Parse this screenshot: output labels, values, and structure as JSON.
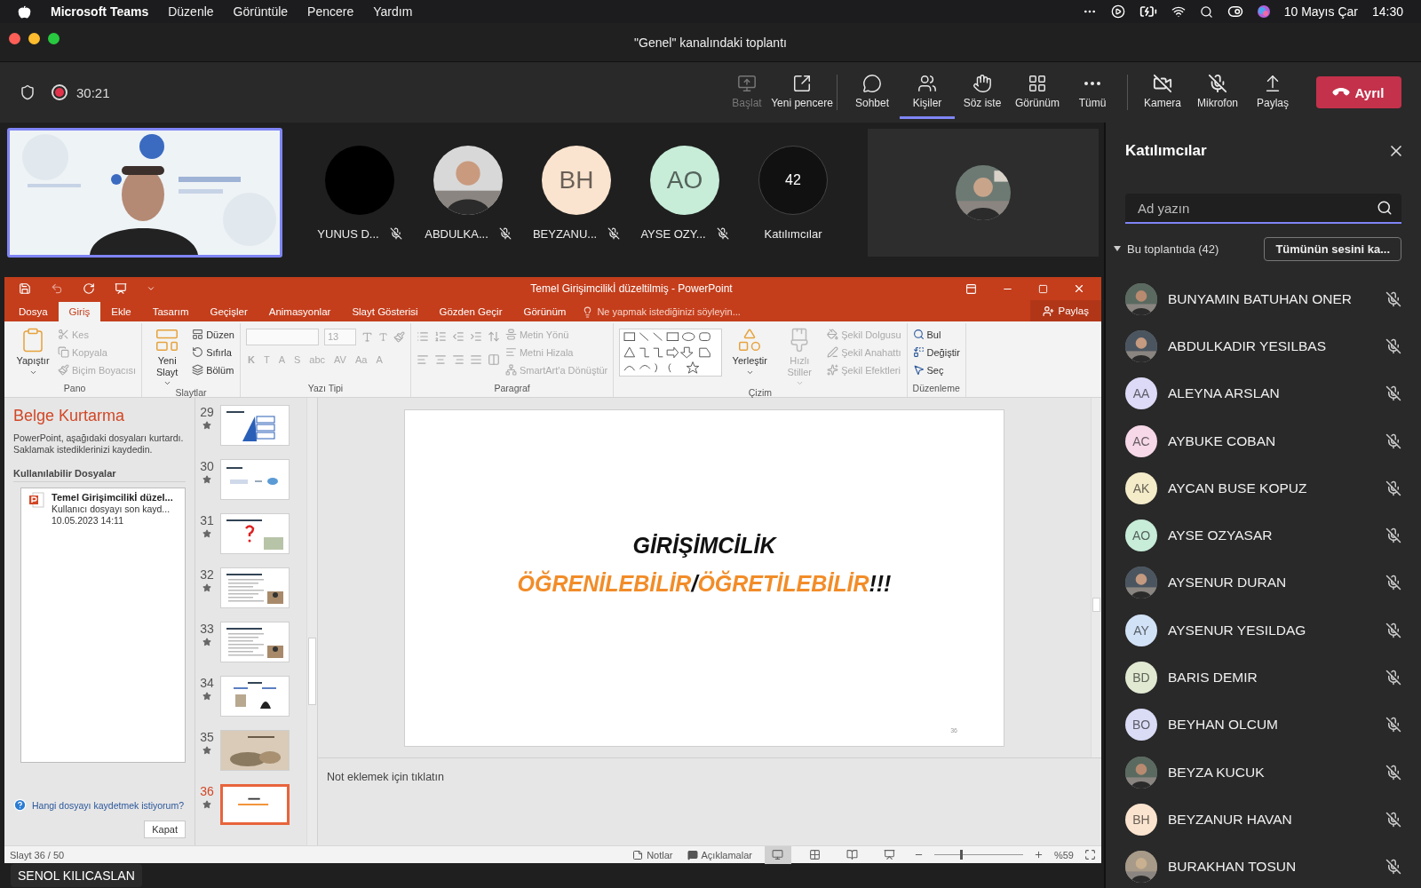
{
  "menu_bar": {
    "app": "Microsoft Teams",
    "items": [
      "Düzenle",
      "Görüntüle",
      "Pencere",
      "Yardım"
    ],
    "date": "10 Mayıs Çar",
    "time": "14:30"
  },
  "window": {
    "title": "\"Genel\" kanalındaki toplantı"
  },
  "meeting_bar": {
    "recording": true,
    "timer": "30:21",
    "groups": [
      [
        {
          "kind": "start",
          "label": "Başlat",
          "disabled": true,
          "selected": false
        },
        {
          "kind": "popout",
          "label": "Yeni pencere",
          "disabled": false,
          "selected": false
        }
      ],
      [
        {
          "kind": "chat",
          "label": "Sohbet",
          "disabled": false,
          "selected": false
        },
        {
          "kind": "people",
          "label": "Kişiler",
          "disabled": false,
          "selected": true
        },
        {
          "kind": "hand",
          "label": "Söz iste",
          "disabled": false,
          "selected": false
        },
        {
          "kind": "view",
          "label": "Görünüm",
          "disabled": false,
          "selected": false
        },
        {
          "kind": "more",
          "label": "Tümü",
          "disabled": false,
          "selected": false
        }
      ],
      [
        {
          "kind": "camera",
          "label": "Kamera",
          "on": false,
          "disabled": false,
          "selected": false
        },
        {
          "kind": "mic",
          "label": "Mikrofon",
          "on": false,
          "disabled": false,
          "selected": false
        },
        {
          "kind": "share",
          "label": "Paylaş",
          "disabled": false,
          "selected": false
        }
      ]
    ],
    "leave": "Ayrıl"
  },
  "video_strip": {
    "tiles": [
      {
        "kind": "blank",
        "name": "YUNUS D...",
        "muted": true
      },
      {
        "name": "ABDULKA...",
        "muted": true
      },
      {
        "kind": "initials",
        "initials": "BH",
        "color": "#fbe4cf",
        "name": "BEYZANU...",
        "muted": true
      },
      {
        "kind": "initials",
        "initials": "AO",
        "color": "#c7ecd8",
        "name": "AYSE OZY...",
        "muted": true
      }
    ],
    "overflow": {
      "count": "42",
      "label": "Katılımcılar"
    }
  },
  "presenter": {
    "name": "SENOL KILICASLAN"
  },
  "participants_panel": {
    "title": "Katılımcılar",
    "search": {
      "placeholder": "Ad yazın"
    },
    "section": {
      "label": "Bu toplantıda (42)",
      "expanded": true
    },
    "mute_all": "Tümünün sesini ka...",
    "people": [
      {
        "name": "BUNYAMIN BATUHAN ONER",
        "muted": true
      },
      {
        "name": "ABDULKADIR YESILBAS",
        "muted": true
      },
      {
        "name": "ALEYNA ARSLAN",
        "kind": "initials",
        "initials": "AA",
        "color": "#dcdaf6",
        "muted": true
      },
      {
        "name": "AYBUKE COBAN",
        "kind": "initials",
        "initials": "AC",
        "color": "#f6d8e8",
        "muted": true
      },
      {
        "name": "AYCAN BUSE KOPUZ",
        "kind": "initials",
        "initials": "AK",
        "color": "#f4ebc9",
        "muted": true
      },
      {
        "name": "AYSE OZYASAR",
        "kind": "initials",
        "initials": "AO",
        "color": "#c7ecd8",
        "muted": true
      },
      {
        "name": "AYSENUR DURAN",
        "muted": true
      },
      {
        "name": "AYSENUR YESILDAG",
        "kind": "initials",
        "initials": "AY",
        "color": "#d2e2f6",
        "muted": true
      },
      {
        "name": "BARIS DEMIR",
        "kind": "initials",
        "initials": "BD",
        "color": "#e1e9d2",
        "muted": true
      },
      {
        "name": "BEYHAN OLCUM",
        "kind": "initials",
        "initials": "BO",
        "color": "#dadcf6",
        "muted": true
      },
      {
        "name": "BEYZA KUCUK",
        "muted": true
      },
      {
        "name": "BEYZANUR HAVAN",
        "kind": "initials",
        "initials": "BH",
        "color": "#fbe4cf",
        "muted": true
      },
      {
        "name": "BURAKHAN TOSUN",
        "muted": true
      }
    ]
  },
  "powerpoint": {
    "title": "Temel Girişimcilikİ düzeltilmiş - PowerPoint",
    "tabs": [
      {
        "label": "Dosya",
        "selected": false
      },
      {
        "label": "Giriş",
        "selected": true
      },
      {
        "label": "Ekle",
        "selected": false
      },
      {
        "label": "Tasarım",
        "selected": false
      },
      {
        "label": "Geçişler",
        "selected": false
      },
      {
        "label": "Animasyonlar",
        "selected": false
      },
      {
        "label": "Slayt Gösterisi",
        "selected": false
      },
      {
        "label": "Gözden Geçir",
        "selected": false
      },
      {
        "label": "Görünüm",
        "selected": false
      }
    ],
    "tell_me": "Ne yapmak istediğinizi söyleyin...",
    "share": "Paylaş",
    "ribbon": [
      {
        "kind": "clipboard",
        "label": "Pano",
        "items": [
          {
            "kind": "large",
            "label": "Yapıştır",
            "disabled": false
          },
          {
            "kind": "small",
            "label": "Kes",
            "disabled": true
          },
          {
            "kind": "small",
            "label": "Kopyala",
            "disabled": true
          },
          {
            "kind": "small",
            "label": "Biçim Boyacısı",
            "disabled": true
          }
        ]
      },
      {
        "kind": "slides",
        "label": "Slaytlar",
        "items": [
          {
            "kind": "large",
            "label": "Yeni Slayt",
            "disabled": false
          },
          {
            "kind": "small",
            "label": "Düzen",
            "disabled": false
          },
          {
            "kind": "small",
            "label": "Sıfırla",
            "disabled": false
          },
          {
            "kind": "small",
            "label": "Bölüm",
            "disabled": false
          }
        ]
      },
      {
        "kind": "font",
        "label": "Yazı Tipi",
        "items": [
          {
            "kind": "field",
            "label": "13",
            "disabled": true
          },
          {
            "kind": "glyph",
            "label": "K",
            "disabled": true
          },
          {
            "kind": "glyph",
            "label": "T",
            "disabled": true
          },
          {
            "kind": "glyph",
            "label": "A",
            "disabled": true
          },
          {
            "kind": "glyph",
            "label": "S",
            "disabled": true
          },
          {
            "kind": "glyph",
            "label": "abc",
            "disabled": true
          },
          {
            "kind": "glyph",
            "label": "AV",
            "disabled": true
          },
          {
            "kind": "glyph",
            "label": "Aa",
            "disabled": true
          },
          {
            "kind": "glyph",
            "label": "A",
            "disabled": true
          }
        ]
      },
      {
        "kind": "paragraph",
        "label": "Paragraf",
        "items": [
          {
            "kind": "small",
            "label": "Metin Yönü",
            "disabled": true
          },
          {
            "kind": "small",
            "label": "Metni Hizala",
            "disabled": true
          },
          {
            "kind": "small",
            "label": "SmartArt'a Dönüştür",
            "disabled": true
          }
        ]
      },
      {
        "kind": "drawing",
        "label": "Çizim",
        "items": [
          {
            "kind": "large",
            "label": "Yerleştir",
            "disabled": false
          },
          {
            "kind": "large",
            "label": "Hızlı Stiller",
            "disabled": true
          },
          {
            "kind": "small",
            "label": "Şekil Dolgusu",
            "disabled": true
          },
          {
            "kind": "small",
            "label": "Şekil Anahattı",
            "disabled": true
          },
          {
            "kind": "small",
            "label": "Şekil Efektleri",
            "disabled": true
          }
        ]
      },
      {
        "kind": "editing",
        "label": "Düzenleme",
        "items": [
          {
            "kind": "small",
            "label": "Bul",
            "disabled": false
          },
          {
            "kind": "small",
            "label": "Değiştir",
            "disabled": false
          },
          {
            "kind": "small",
            "label": "Seç",
            "disabled": false
          }
        ]
      }
    ],
    "recovery": {
      "title": "Belge Kurtarma",
      "description": "PowerPoint, aşağıdaki dosyaları kurtardı. Saklamak istediklerinizi kaydedin.",
      "list_title": "Kullanılabilir Dosyalar",
      "files": [
        {
          "name": "Temel Girişimcilikİ düzel...",
          "detail": "Kullanıcı dosyayı son kayd...",
          "date": "10.05.2023 14:11"
        }
      ],
      "help": "Hangi dosyayı kaydetmek istiyorum?",
      "close": "Kapat"
    },
    "thumbnails": [
      {
        "number": "29",
        "kind": "diagram",
        "selected": false
      },
      {
        "number": "30",
        "kind": "flow",
        "selected": false
      },
      {
        "number": "31",
        "kind": "question",
        "selected": false
      },
      {
        "number": "32",
        "kind": "text-photo",
        "selected": false
      },
      {
        "number": "33",
        "kind": "text-photo",
        "selected": false
      },
      {
        "number": "34",
        "kind": "two-photos",
        "selected": false
      },
      {
        "number": "35",
        "kind": "picture",
        "selected": false
      },
      {
        "number": "36",
        "kind": "title",
        "selected": true
      }
    ],
    "slide": {
      "lines": [
        [
          {
            "text": "GİRİŞİMCİLİK",
            "color": "#111111"
          }
        ],
        [
          {
            "text": "ÖĞRENİLEBİLİR",
            "color": "#f28c28"
          },
          {
            "text": "/",
            "color": "#111111"
          },
          {
            "text": "ÖĞRETİLEBİLİR",
            "color": "#f28c28"
          },
          {
            "text": "!!!",
            "color": "#111111"
          }
        ]
      ],
      "number": "36"
    },
    "notes": {
      "placeholder": "Not eklemek için tıklatın"
    },
    "status_bar": {
      "slide": "Slayt 36 / 50",
      "notes": "Notlar",
      "comments": "Açıklamalar",
      "zoom": {
        "level": 0.3,
        "reading": "%59"
      }
    }
  }
}
